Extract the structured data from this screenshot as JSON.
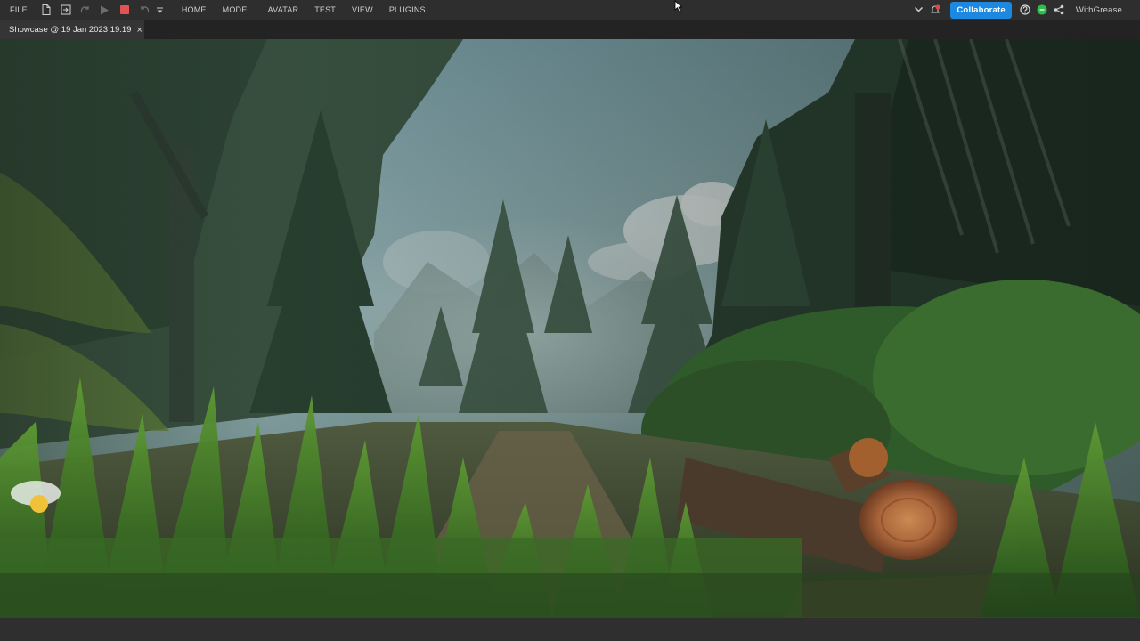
{
  "menubar": {
    "file_label": "FILE",
    "tabs": [
      "HOME",
      "MODEL",
      "AVATAR",
      "TEST",
      "VIEW",
      "PLUGINS"
    ],
    "tool_icons": [
      "new-file-icon",
      "open-file-icon",
      "redo-icon",
      "play-icon",
      "stop-icon",
      "undo-icon",
      "quick-access-dropdown-icon"
    ],
    "collaborate_label": "Collaborate",
    "username": "WithGrease"
  },
  "document_tab": {
    "title": "Showcase @ 19 Jan 2023 19:19",
    "close_glyph": "×"
  },
  "colors": {
    "menubar_bg": "#2e2e2e",
    "collaborate_blue": "#1c88e0",
    "status_green": "#2dbd4e",
    "notification_red": "#e04848"
  }
}
